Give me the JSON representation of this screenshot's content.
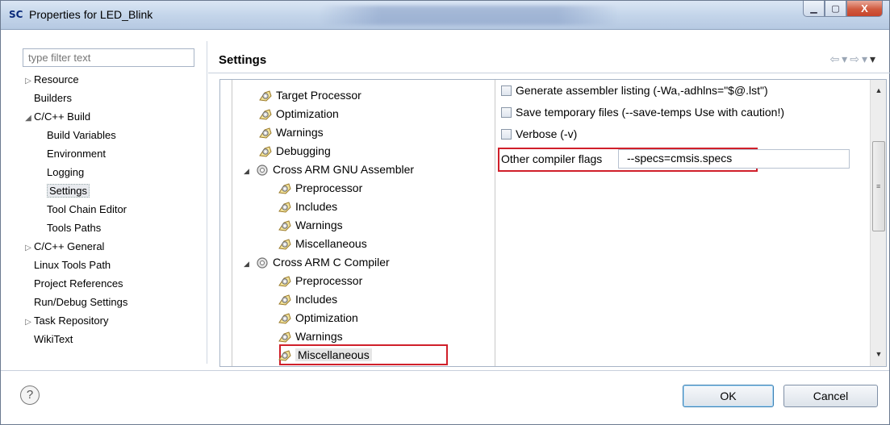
{
  "window": {
    "app_icon_text": "SC",
    "title": "Properties for LED_Blink",
    "controls": {
      "minimize_icon": "minimize-icon",
      "maximize_icon": "maximize-icon",
      "close_icon": "close-icon",
      "close_glyph": "X"
    }
  },
  "left": {
    "filter_placeholder": "type filter text",
    "tree": [
      {
        "label": "Resource",
        "toggle": "▷"
      },
      {
        "label": "Builders"
      },
      {
        "label": "C/C++ Build",
        "toggle": "◢"
      },
      {
        "label": "Build Variables"
      },
      {
        "label": "Environment"
      },
      {
        "label": "Logging"
      },
      {
        "label": "Settings",
        "selected": true
      },
      {
        "label": "Tool Chain Editor"
      },
      {
        "label": "Tools Paths"
      },
      {
        "label": "C/C++ General",
        "toggle": "▷"
      },
      {
        "label": "Linux Tools Path"
      },
      {
        "label": "Project References"
      },
      {
        "label": "Run/Debug Settings"
      },
      {
        "label": "Task Repository",
        "toggle": "▷"
      },
      {
        "label": "WikiText"
      }
    ]
  },
  "header": {
    "title": "Settings"
  },
  "tools": [
    {
      "label": "Target Processor"
    },
    {
      "label": "Optimization"
    },
    {
      "label": "Warnings"
    },
    {
      "label": "Debugging"
    },
    {
      "label": "Cross ARM GNU Assembler",
      "toggle": "◢"
    },
    {
      "label": "Preprocessor"
    },
    {
      "label": "Includes"
    },
    {
      "label": "Warnings"
    },
    {
      "label": "Miscellaneous"
    },
    {
      "label": "Cross ARM C Compiler",
      "toggle": "◢"
    },
    {
      "label": "Preprocessor"
    },
    {
      "label": "Includes"
    },
    {
      "label": "Optimization"
    },
    {
      "label": "Warnings"
    },
    {
      "label": "Miscellaneous",
      "selected": true
    }
  ],
  "options": {
    "checkboxes": [
      {
        "label": "Generate assembler listing (-Wa,-adhlns=\"$@.lst\")",
        "checked": false
      },
      {
        "label": "Save temporary files (--save-temps Use with caution!)",
        "checked": false
      },
      {
        "label": "Verbose (-v)",
        "checked": false
      }
    ],
    "other_flags_label": "Other compiler flags",
    "other_flags_value": "--specs=cmsis.specs"
  },
  "buttons": {
    "ok": "OK",
    "cancel": "Cancel",
    "help_glyph": "?"
  },
  "colors": {
    "highlight": "#d01f2a",
    "titlebar": "#c4d5ea"
  }
}
